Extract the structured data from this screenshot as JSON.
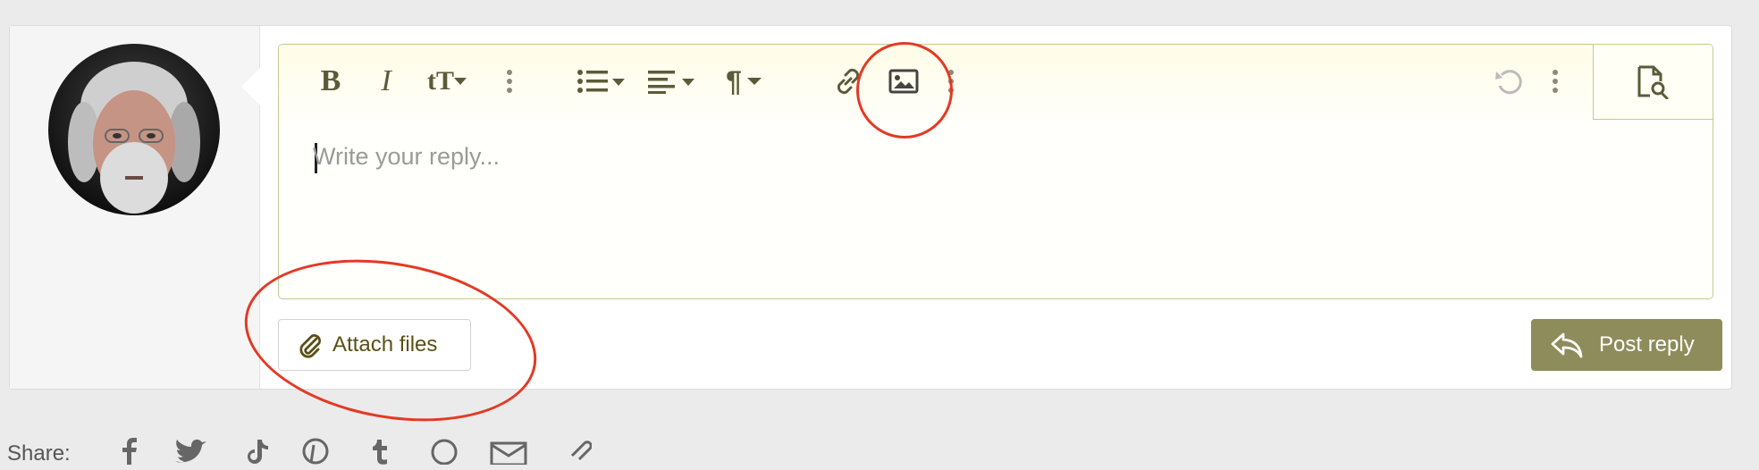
{
  "editor": {
    "placeholder": "Write your reply...",
    "toolbar": {
      "bold": "B",
      "italic": "I",
      "text_size": "tT",
      "paragraph": "¶"
    }
  },
  "actions": {
    "attach_label": "Attach files",
    "post_label": "Post reply"
  },
  "share": {
    "label": "Share:",
    "icons": [
      "facebook-icon",
      "twitter-icon",
      "tiktok-icon",
      "pinterest-icon",
      "tumblr-icon",
      "whatsapp-icon",
      "email-icon",
      "link-icon"
    ]
  },
  "colors": {
    "accent": "#8e8c5a",
    "editor_border": "#c6c994",
    "annotation_red": "#e23a25"
  }
}
